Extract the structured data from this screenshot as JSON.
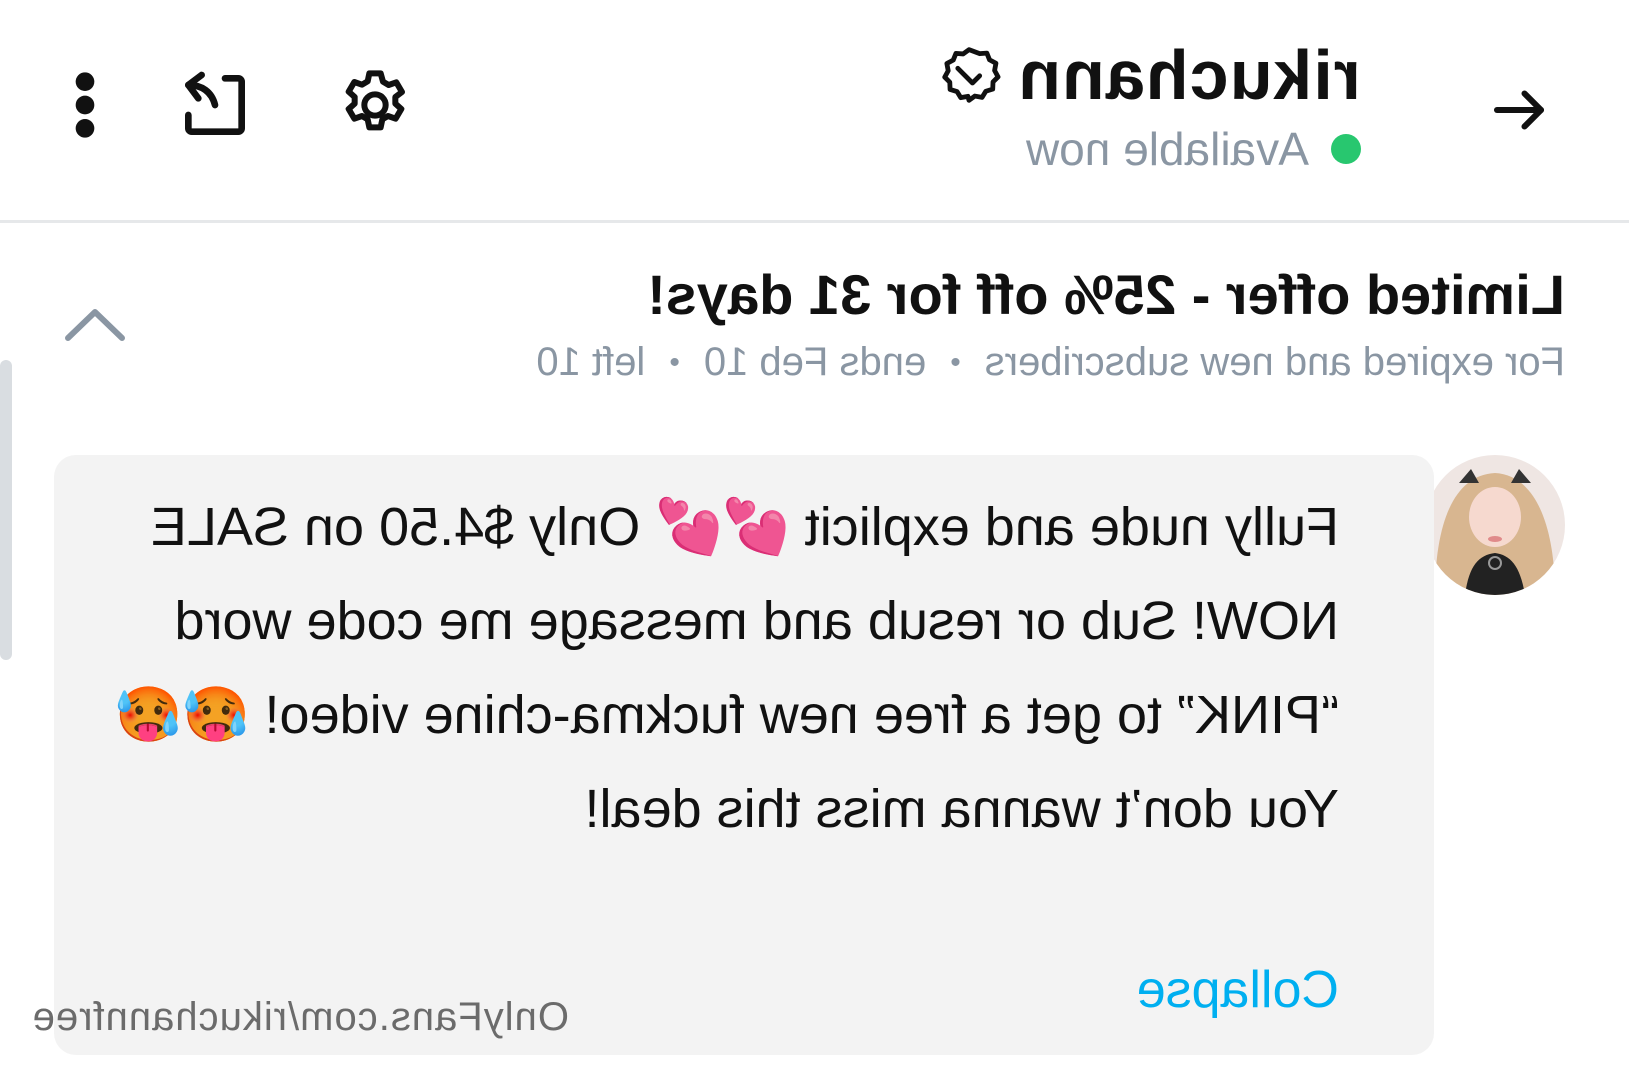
{
  "header": {
    "username": "rikuchann",
    "status": "Available now",
    "icons": [
      "arrow-back-icon",
      "verified-icon",
      "gear-icon",
      "share-icon",
      "more-vertical-icon"
    ]
  },
  "offer": {
    "title": "Limited offer - 25% off for 31 days!",
    "audience": "For expired and new subscribers",
    "ends": "ends Feb 10",
    "left": "left 10"
  },
  "message": {
    "text": "Fully nude and explicit 💕💕 Only $4.50 on SALE NOW! Sub or resub and message me code word “PINK” to get a free new fuckma-chine video! 🥵🥵 You don’t wanna miss this deal!",
    "collapse_label": "Collapse"
  },
  "watermark": "OnlyFans.com/rikuchannfree",
  "colors": {
    "accent": "#00aff0",
    "online": "#28c76f",
    "muted": "#8a96a3",
    "bubble": "#f3f3f3"
  }
}
